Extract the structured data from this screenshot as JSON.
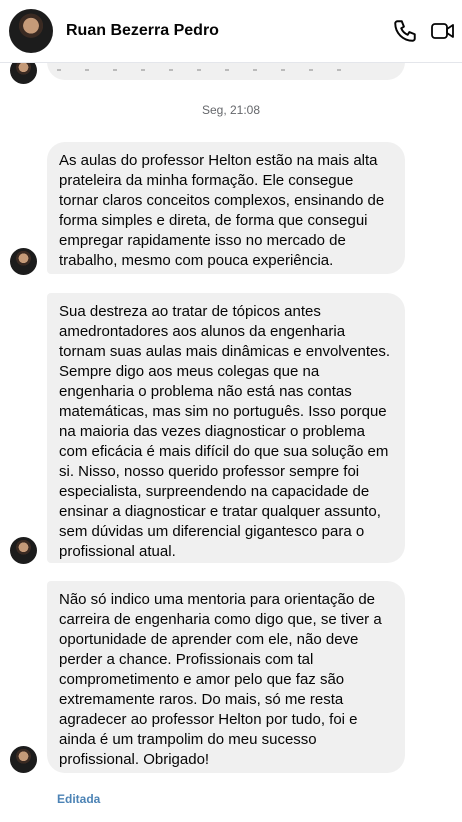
{
  "header": {
    "contact_name": "Ruan Bezerra Pedro",
    "icons": [
      "avatar",
      "phone-icon",
      "video-icon"
    ]
  },
  "timestamp": "Seg, 21:08",
  "messages": [
    {
      "text": "As aulas do professor Helton estão na mais alta prateleira da minha formação. Ele consegue tornar claros conceitos complexos, ensinando de forma simples e direta, de forma que consegui empregar rapidamente isso no mercado de trabalho, mesmo com pouca experiência."
    },
    {
      "text": "Sua destreza ao tratar de tópicos antes amedrontadores aos alunos da engenharia tornam suas aulas mais dinâmicas e envolventes. Sempre digo aos meus colegas que na engenharia o problema não está nas contas matemáticas, mas sim no português. Isso porque na maioria das vezes diagnosticar o problema com eficácia é mais difícil do que sua solução em si. Nisso, nosso querido professor sempre foi especialista, surpreendendo na capacidade de ensinar a diagnosticar e tratar qualquer assunto, sem dúvidas um diferencial gigantesco para o profissional atual."
    },
    {
      "text": "Não só indico uma mentoria para orientação de carreira de engenharia como digo que, se tiver a oportunidade de aprender com ele, não deve perder a chance. Profissionais com tal comprometimento e amor pelo que faz são extremamente raros. Do mais, só me resta agradecer ao professor Helton por tudo, foi e ainda é um trampolim do meu sucesso profissional. Obrigado!"
    }
  ],
  "edited_label": "Editada",
  "colors": {
    "bubble": "#f0f0f0",
    "edited": "#4c83b5",
    "timestamp": "#65676b"
  }
}
